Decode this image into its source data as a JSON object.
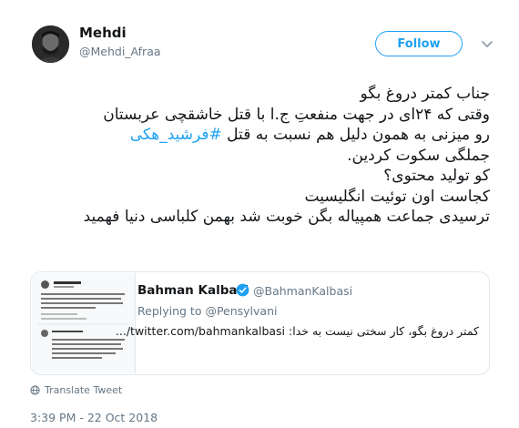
{
  "author": {
    "display_name": "Mehdi",
    "handle": "@Mehdi_Afraa"
  },
  "follow_label": "Follow",
  "tweet": {
    "lines": [
      "جناب کمتر دروغ بگو",
      "وقتی که ۲۴ای در جهت منفعتِ ج.ا با قتل خاشقچی عربستان",
      "رو میزنی به همون دلیل هم نسبت به قتل ",
      "جملگی سکوت کردین.",
      "کو تولید محتوی؟",
      "کجاست اون توئیت انگلیسیت",
      "ترسیدی جماعت همپیاله بگن خوبت شد بهمن کلباسی دنیا فهمید"
    ],
    "hashtag": "#فرشید_هکی"
  },
  "quoted": {
    "name": "Bahman Kalbasi",
    "handle": "@BahmanKalbasi",
    "reply_text": "Replying to @Pensylvani",
    "body": "کمتر دروغ بگو، کار سختی نیست به خدا: twitter.com/bahmankalbasi/..."
  },
  "translate_label": "Translate Tweet",
  "timestamp": "3:39 PM - 22 Oct 2018",
  "colors": {
    "accent": "#1da1f2",
    "text": "#14171a",
    "muted": "#657786",
    "border": "#e1e8ed"
  },
  "icons": [
    "avatar",
    "chevron-down-icon",
    "verified-badge-icon",
    "globe-icon"
  ]
}
